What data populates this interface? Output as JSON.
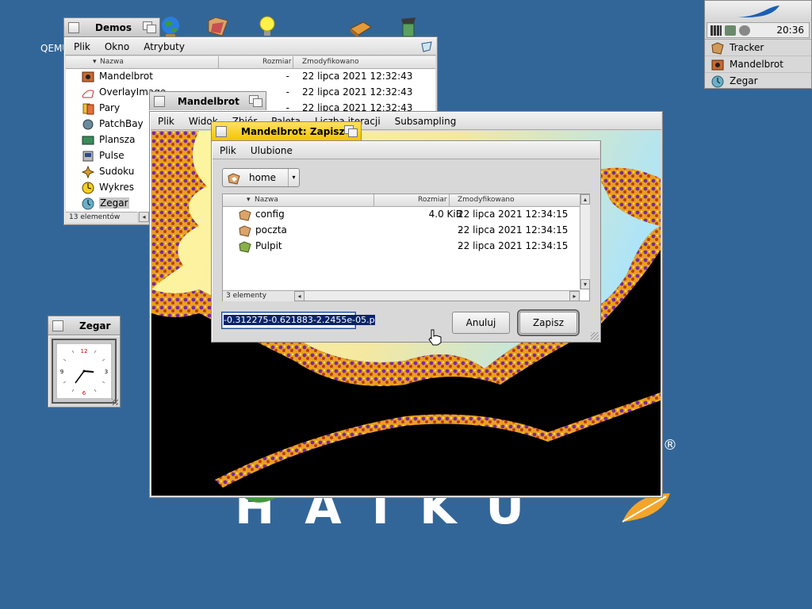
{
  "desktop": {
    "qemu_label": "QEMU",
    "logo_text": "HAIKU",
    "logo_registered": "®"
  },
  "deskbar": {
    "clock": "20:36",
    "items": [
      {
        "label": "Tracker",
        "icon": "tracker-icon"
      },
      {
        "label": "Mandelbrot",
        "icon": "mandelbrot-icon"
      },
      {
        "label": "Zegar",
        "icon": "clock-icon"
      }
    ]
  },
  "demos_window": {
    "title": "Demos",
    "menu": [
      "Plik",
      "Okno",
      "Atrybuty"
    ],
    "columns": {
      "name": "Nazwa",
      "size": "Rozmiar",
      "modified": "Zmodyfikowano"
    },
    "rows": [
      {
        "name": "Mandelbrot",
        "size": "-",
        "date": "22 lipca 2021 12:32:43"
      },
      {
        "name": "OverlayImage",
        "size": "-",
        "date": "22 lipca 2021 12:32:43"
      },
      {
        "name": "Pary",
        "size": "-",
        "date": "22 lipca 2021 12:32:43"
      },
      {
        "name": "PatchBay",
        "size": "",
        "date": ""
      },
      {
        "name": "Plansza",
        "size": "",
        "date": ""
      },
      {
        "name": "Pulse",
        "size": "",
        "date": ""
      },
      {
        "name": "Sudoku",
        "size": "",
        "date": ""
      },
      {
        "name": "Wykres",
        "size": "",
        "date": ""
      },
      {
        "name": "Zegar",
        "size": "",
        "date": ""
      }
    ],
    "status": "13 elementów"
  },
  "mandelbrot_window": {
    "title": "Mandelbrot",
    "menu": [
      "Plik",
      "Widok",
      "Zbiór",
      "Paleta",
      "Liczba iteracji",
      "Subsampling"
    ]
  },
  "save_dialog": {
    "title": "Mandelbrot: Zapisz",
    "menu": [
      "Plik",
      "Ulubione"
    ],
    "location": "home",
    "columns": {
      "name": "Nazwa",
      "size": "Rozmiar",
      "modified": "Zmodyfikowano"
    },
    "rows": [
      {
        "name": "config",
        "size": "4.0 KiB",
        "date": "22 lipca 2021 12:34:15"
      },
      {
        "name": "poczta",
        "size": "-",
        "date": "22 lipca 2021 12:34:15"
      },
      {
        "name": "Pulpit",
        "size": "-",
        "date": "22 lipca 2021 12:34:15"
      }
    ],
    "status": "3 elementy",
    "filename": "-0.312275-0.621883-2.2455e-05.p",
    "cancel_label": "Anuluj",
    "save_label": "Zapisz"
  },
  "clock_window": {
    "title": "Zegar",
    "numerals": [
      "12",
      "3",
      "6",
      "9"
    ]
  }
}
